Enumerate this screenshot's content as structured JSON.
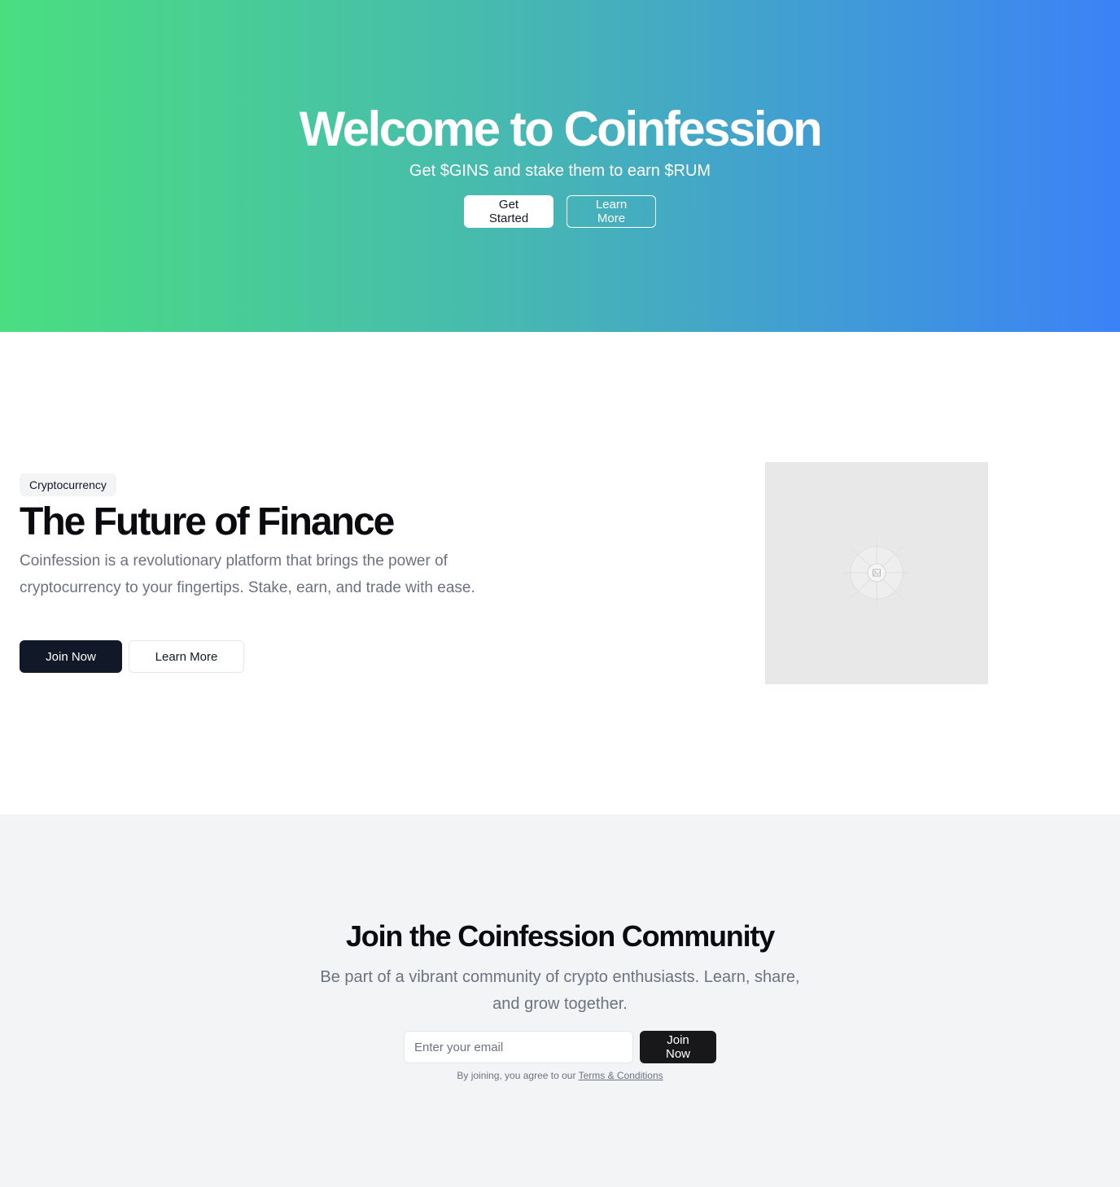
{
  "hero": {
    "title": "Welcome to Coinfession",
    "subtitle": "Get $GINS and stake them to earn $RUM",
    "primary_label": "Get Started",
    "secondary_label": "Learn More"
  },
  "feature": {
    "badge": "Cryptocurrency",
    "title": "The Future of Finance",
    "description": "Coinfession is a revolutionary platform that brings the power of cryptocurrency to your fingertips. Stake, earn, and trade with ease.",
    "primary_label": "Join Now",
    "secondary_label": "Learn More",
    "image_icon": "image-placeholder-icon"
  },
  "community": {
    "title": "Join the Coinfession Community",
    "description": "Be part of a vibrant community of crypto enthusiasts. Learn, share, and grow together.",
    "email_placeholder": "Enter your email",
    "email_value": "",
    "join_label": "Join Now",
    "legal_prefix": "By joining, you agree to our ",
    "legal_link": "Terms & Conditions"
  },
  "colors": {
    "gradient_start": "#4ade80",
    "gradient_end": "#3b82f6",
    "dark_button": "#111827",
    "community_bg": "#f3f4f6"
  }
}
